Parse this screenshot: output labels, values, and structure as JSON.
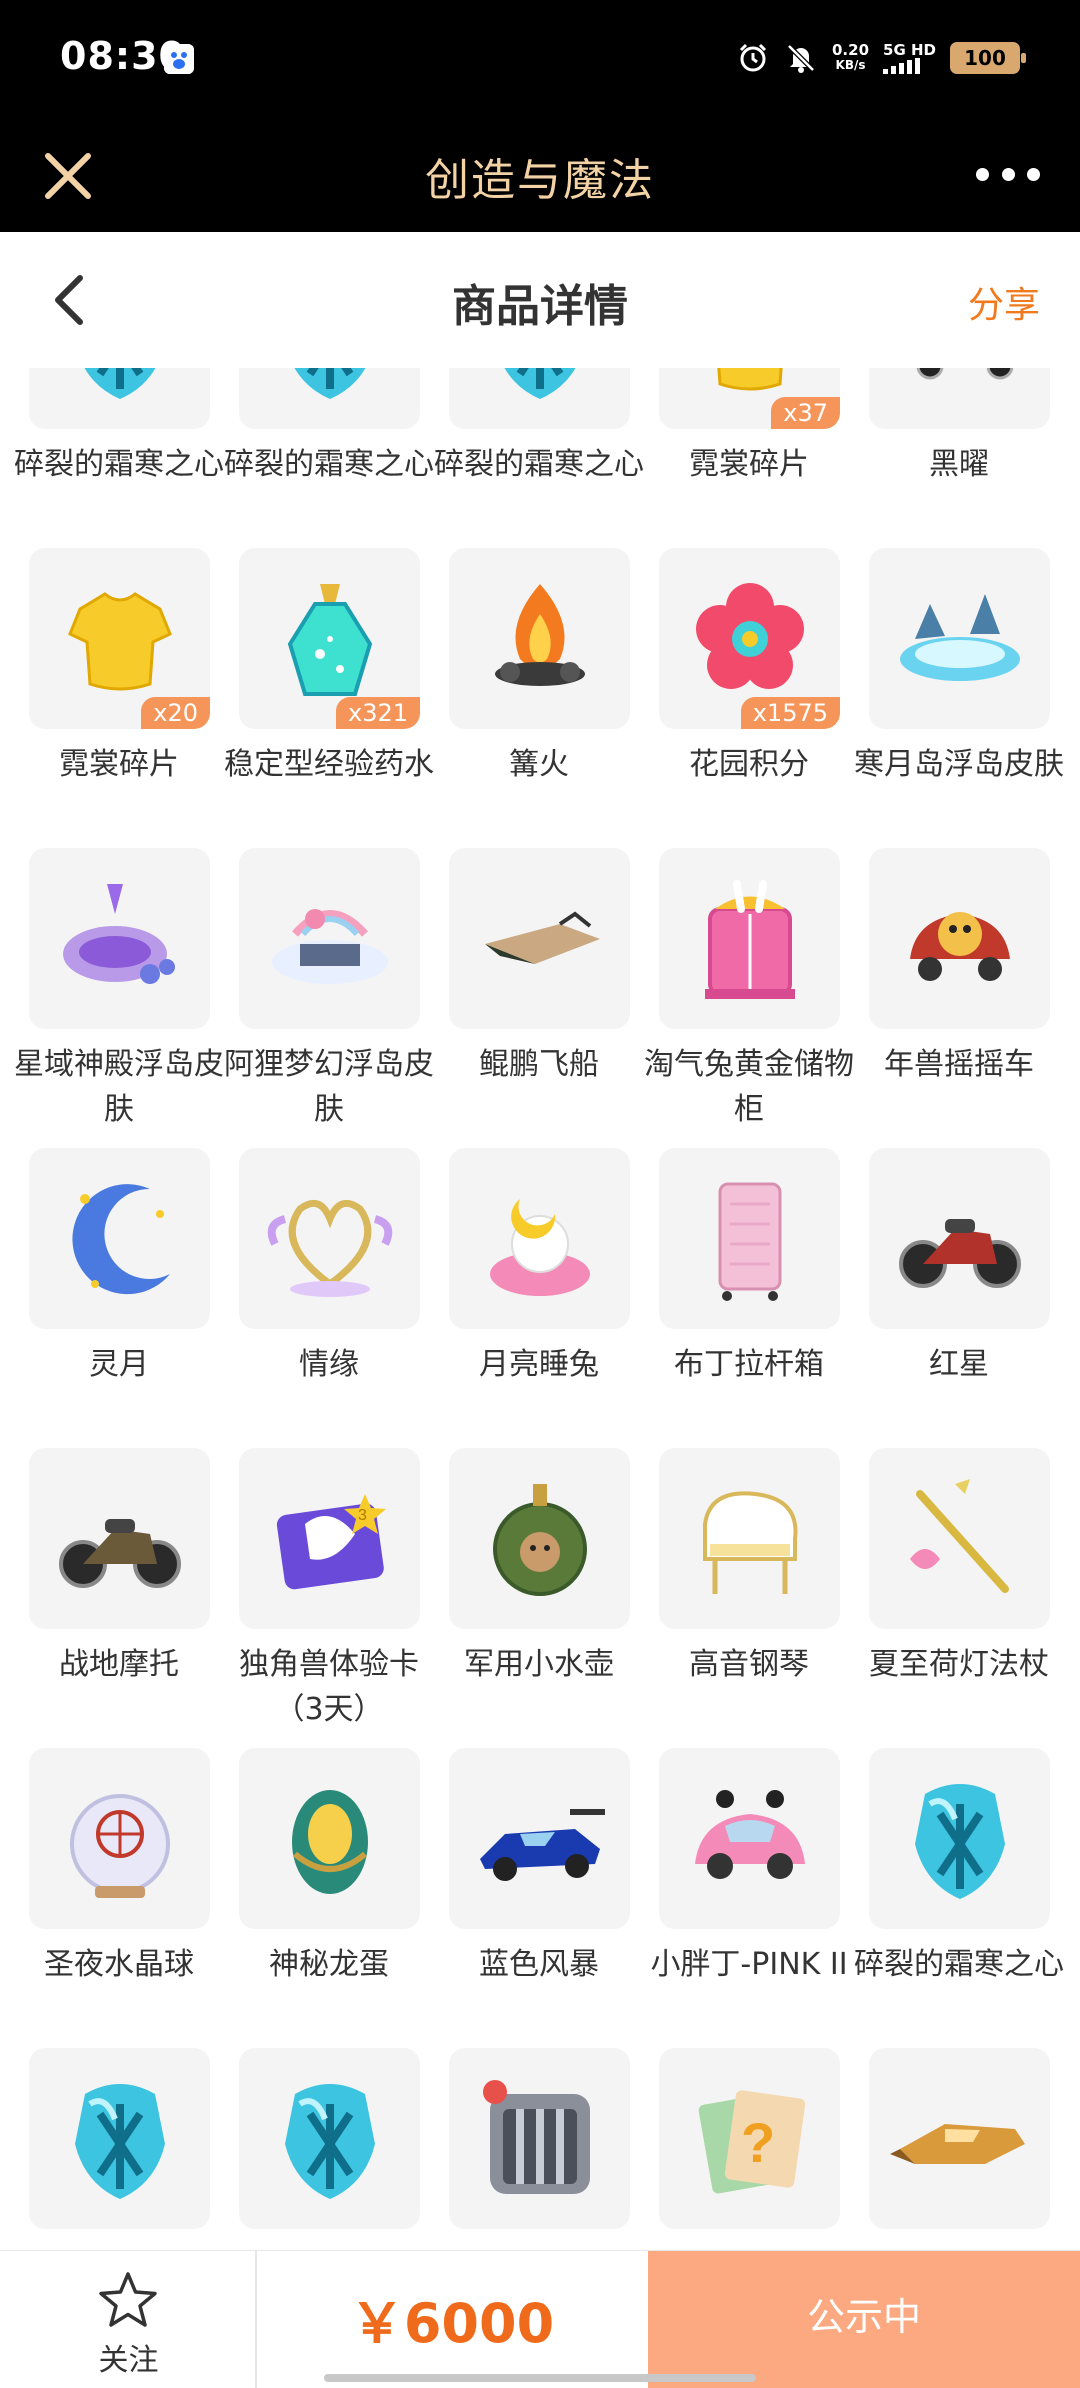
{
  "status_bar": {
    "time": "08:30",
    "net_speed_value": "0.20",
    "net_speed_unit": "KB/s",
    "network": "5G HD",
    "battery": "100",
    "icons": [
      "baidu-app-icon",
      "alarm-icon",
      "mute-icon",
      "signal-icon",
      "battery-icon"
    ]
  },
  "app_bar": {
    "title": "创造与魔法",
    "close_icon": "close-icon",
    "more_icon": "more-icon",
    "title_color": "#f3d3a5"
  },
  "header": {
    "title": "商品详情",
    "share_label": "分享",
    "back_icon": "chevron-left-icon",
    "accent": "#f07a1d"
  },
  "items": [
    {
      "name": "碎裂的霜寒之心",
      "icon": "frost-heart-icon"
    },
    {
      "name": "碎裂的霜寒之心",
      "icon": "frost-heart-icon"
    },
    {
      "name": "碎裂的霜寒之心",
      "icon": "frost-heart-icon"
    },
    {
      "name": "霓裳碎片",
      "icon": "yellow-shirt-icon",
      "badge": "x37"
    },
    {
      "name": "黑曜",
      "icon": "dark-car-icon"
    },
    {
      "name": "霓裳碎片",
      "icon": "yellow-shirt-icon",
      "badge": "x20"
    },
    {
      "name": "稳定型经验药水",
      "icon": "potion-icon",
      "badge": "x321"
    },
    {
      "name": "篝火",
      "icon": "campfire-icon"
    },
    {
      "name": "花园积分",
      "icon": "flower-icon",
      "badge": "x1575"
    },
    {
      "name": "寒月岛浮岛皮肤",
      "icon": "ice-island-icon"
    },
    {
      "name": "星域神殿浮岛皮肤",
      "icon": "star-temple-icon"
    },
    {
      "name": "阿狸梦幻浮岛皮肤",
      "icon": "dream-island-icon"
    },
    {
      "name": "鲲鹏飞船",
      "icon": "airship-icon"
    },
    {
      "name": "淘气兔黄金储物柜",
      "icon": "bunny-cabinet-icon"
    },
    {
      "name": "年兽摇摇车",
      "icon": "beast-cart-icon"
    },
    {
      "name": "灵月",
      "icon": "crescent-moon-icon"
    },
    {
      "name": "情缘",
      "icon": "heart-wings-icon"
    },
    {
      "name": "月亮睡兔",
      "icon": "moon-rabbit-icon"
    },
    {
      "name": "布丁拉杆箱",
      "icon": "pink-suitcase-icon"
    },
    {
      "name": "红星",
      "icon": "motorcycle-icon"
    },
    {
      "name": "战地摩托",
      "icon": "war-motorcycle-icon"
    },
    {
      "name": "独角兽体验卡（3天）",
      "icon": "unicorn-card-icon"
    },
    {
      "name": "军用小水壶",
      "icon": "canteen-icon"
    },
    {
      "name": "高音钢琴",
      "icon": "piano-icon"
    },
    {
      "name": "夏至荷灯法杖",
      "icon": "lotus-staff-icon"
    },
    {
      "name": "圣夜水晶球",
      "icon": "crystal-ball-icon"
    },
    {
      "name": "神秘龙蛋",
      "icon": "dragon-egg-icon"
    },
    {
      "name": "蓝色风暴",
      "icon": "blue-racecar-icon"
    },
    {
      "name": "小胖丁-PINK II",
      "icon": "pink-beetle-icon"
    },
    {
      "name": "碎裂的霜寒之心",
      "icon": "frost-heart-icon"
    },
    {
      "name": "",
      "icon": "frost-heart-icon"
    },
    {
      "name": "",
      "icon": "frost-heart-icon"
    },
    {
      "name": "",
      "icon": "pet-crate-icon"
    },
    {
      "name": "",
      "icon": "mystery-card-icon"
    },
    {
      "name": "",
      "icon": "gold-jet-icon"
    }
  ],
  "bottom_bar": {
    "follow_label": "关注",
    "follow_icon": "star-icon",
    "price": "￥6000",
    "status_label": "公示中",
    "price_color": "#ef6a1a",
    "status_color": "#fca880"
  }
}
